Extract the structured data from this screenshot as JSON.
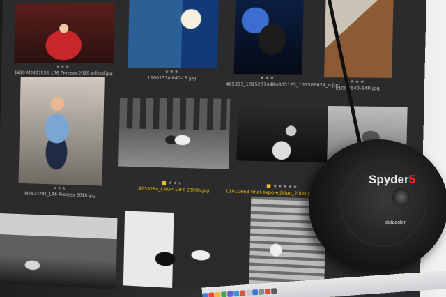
{
  "thumbnails": [
    {
      "id": "t1",
      "caption": "1619-M2427836_LR6-Process-2010-edited.jpg",
      "stars": "★★★"
    },
    {
      "id": "t2",
      "caption": "L1001534-640-LR.jpg",
      "stars": "★★★"
    },
    {
      "id": "t3",
      "caption": "465337_10152074484835125_105506624_o.jpg",
      "stars": "★★★"
    },
    {
      "id": "t4",
      "caption": "L1003640-640.jpg",
      "stars": "★★★"
    },
    {
      "id": "t5",
      "caption": "M2423281_LR6-Process-2010.jpg",
      "stars": "★★★"
    },
    {
      "id": "t6",
      "caption": "L9050264_CROP_GIFT-2000h.jpg",
      "stars": "★★★"
    },
    {
      "id": "t7",
      "caption": "L1010663-final-expo-edition_2000-pixels-72-dpi.jpg",
      "stars": "★★★★★"
    }
  ],
  "device": {
    "brand_main": "Spyder",
    "brand_number": "5",
    "maker": "datacolor"
  },
  "colors": {
    "background": "#1a1a1a",
    "screen": "#2b2b2d",
    "selected_caption": "#f0c400",
    "brand_red": "#ff2b2b"
  }
}
